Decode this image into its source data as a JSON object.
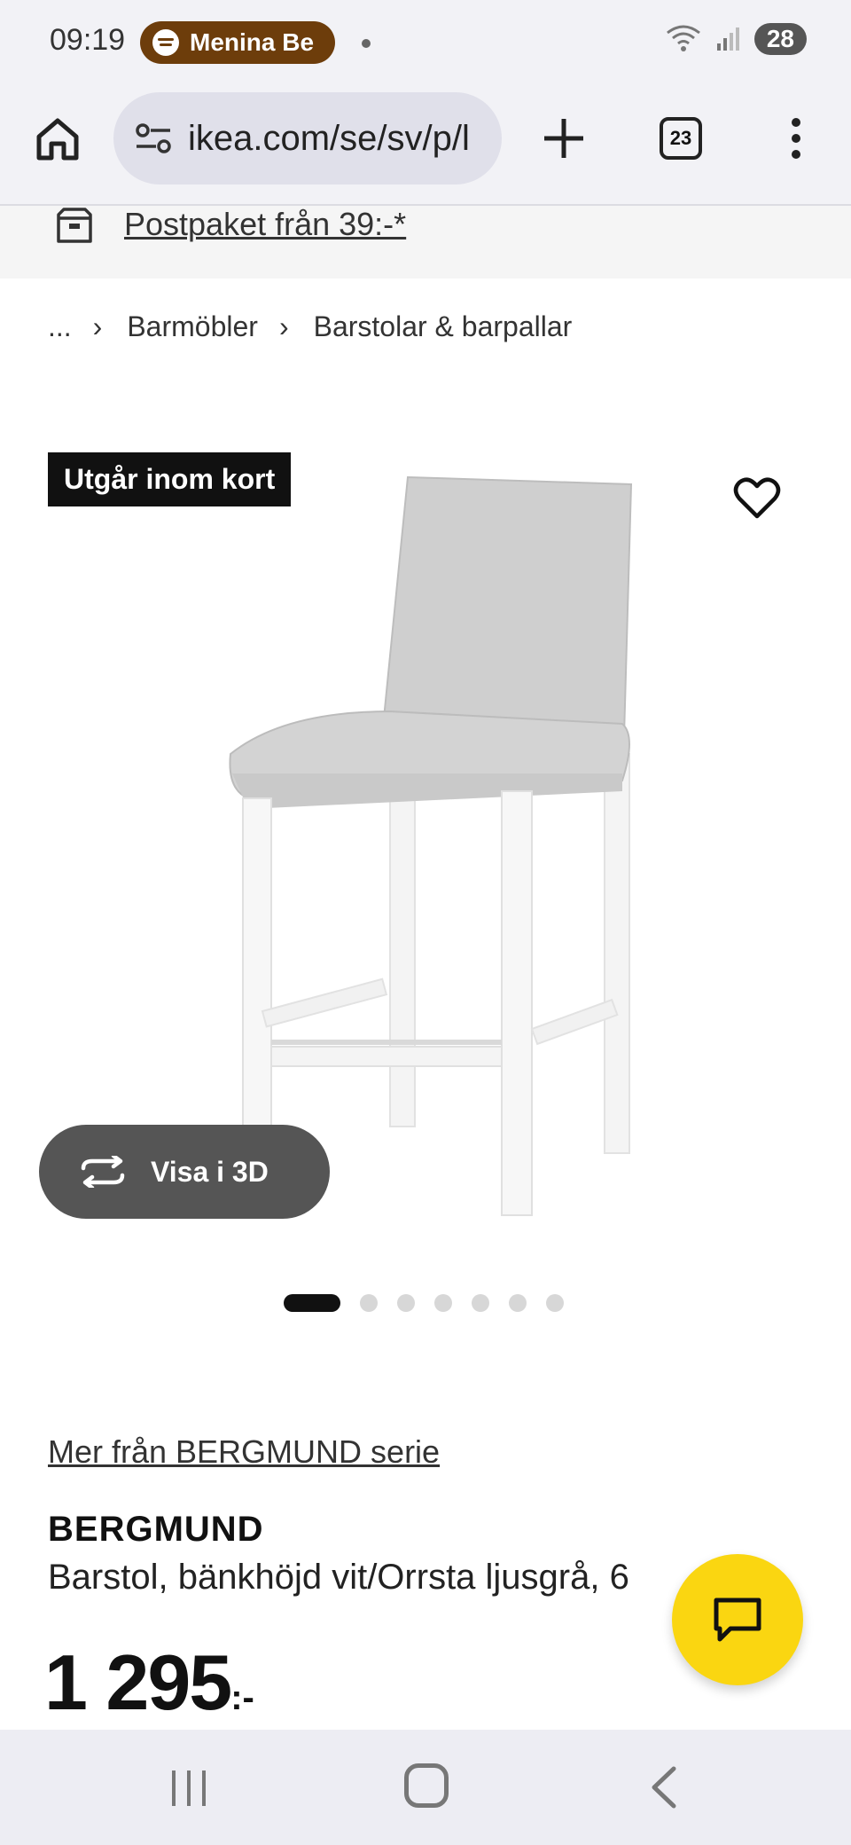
{
  "status_bar": {
    "time": "09:19",
    "media_label": "Menina Be",
    "battery": "28"
  },
  "browser": {
    "url": "ikea.com/se/sv/p/l",
    "tab_count": "23"
  },
  "banner": {
    "text": "Postpaket från 39:-*"
  },
  "breadcrumb": {
    "ellipsis": "...",
    "items": [
      "Barmöbler",
      "Barstolar & barpallar"
    ]
  },
  "product": {
    "badge": "Utgår inom kort",
    "view_3d_label": "Visa i 3D",
    "series_link": "Mer från BERGMUND serie",
    "name": "BERGMUND",
    "description": "Barstol, bänkhöjd vit/Orrsta ljusgrå, 6",
    "price": "1 295",
    "price_suffix": ":-",
    "image_count": 7,
    "active_image": 1
  },
  "colors": {
    "badge_bg": "#111111",
    "fab_yellow": "#fad611",
    "media_pill": "#6d3d0b"
  }
}
